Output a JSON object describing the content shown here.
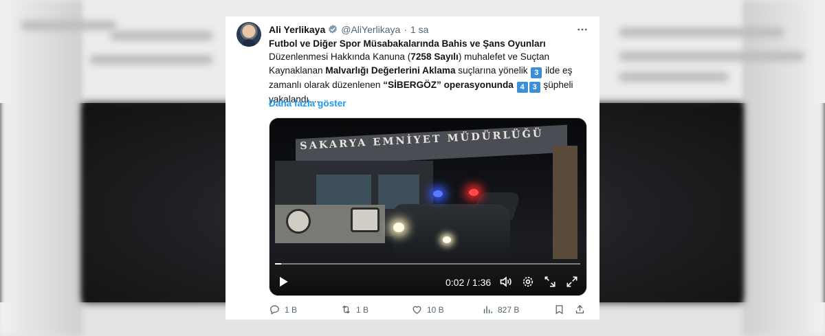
{
  "tweet": {
    "author_name": "Ali Yerlikaya",
    "author_handle": "@AliYerlikaya",
    "separator": "·",
    "time": "1 sa",
    "text_segments": {
      "s1": "Futbol ve Diğer Spor Müsabakalarında Bahis ve Şans Oyunları",
      "s2": " Düzenlenmesi Hakkında Kanuna (",
      "s3": "7258 Sayılı",
      "s4": ") muhalefet ve Suçtan Kaynaklanan ",
      "s5": "Malvarlığı Değerlerini Aklama",
      "s6": " suçlarına yönelik ",
      "n1": "3",
      "s7": " ilde eş zamanlı olarak düzenlenen ",
      "s8": "“SİBERGÖZ” operasyonunda",
      "n2": "4",
      "n3": "3",
      "s9": " şüpheli yakalandı...."
    },
    "show_more": "Daha fazla göster",
    "video": {
      "sign_text": "SAKARYA EMNİYET MÜDÜRLÜĞÜ",
      "timecode": "0:02 / 1:36",
      "progress": 0.02
    },
    "actions": {
      "reply_count": "1 B",
      "retweet_count": "1 B",
      "like_count": "10 B",
      "view_count": "827 B"
    }
  },
  "colors": {
    "accent": "#1d9bf0",
    "text_primary": "#0f1419",
    "text_secondary": "#536471",
    "number_badge": "#3b8ed8"
  },
  "icons": [
    "verified-badge-icon",
    "more-icon",
    "play-icon",
    "volume-icon",
    "settings-icon",
    "minimize-icon",
    "fullscreen-icon",
    "reply-icon",
    "retweet-icon",
    "like-icon",
    "views-icon",
    "bookmark-icon",
    "share-icon"
  ]
}
